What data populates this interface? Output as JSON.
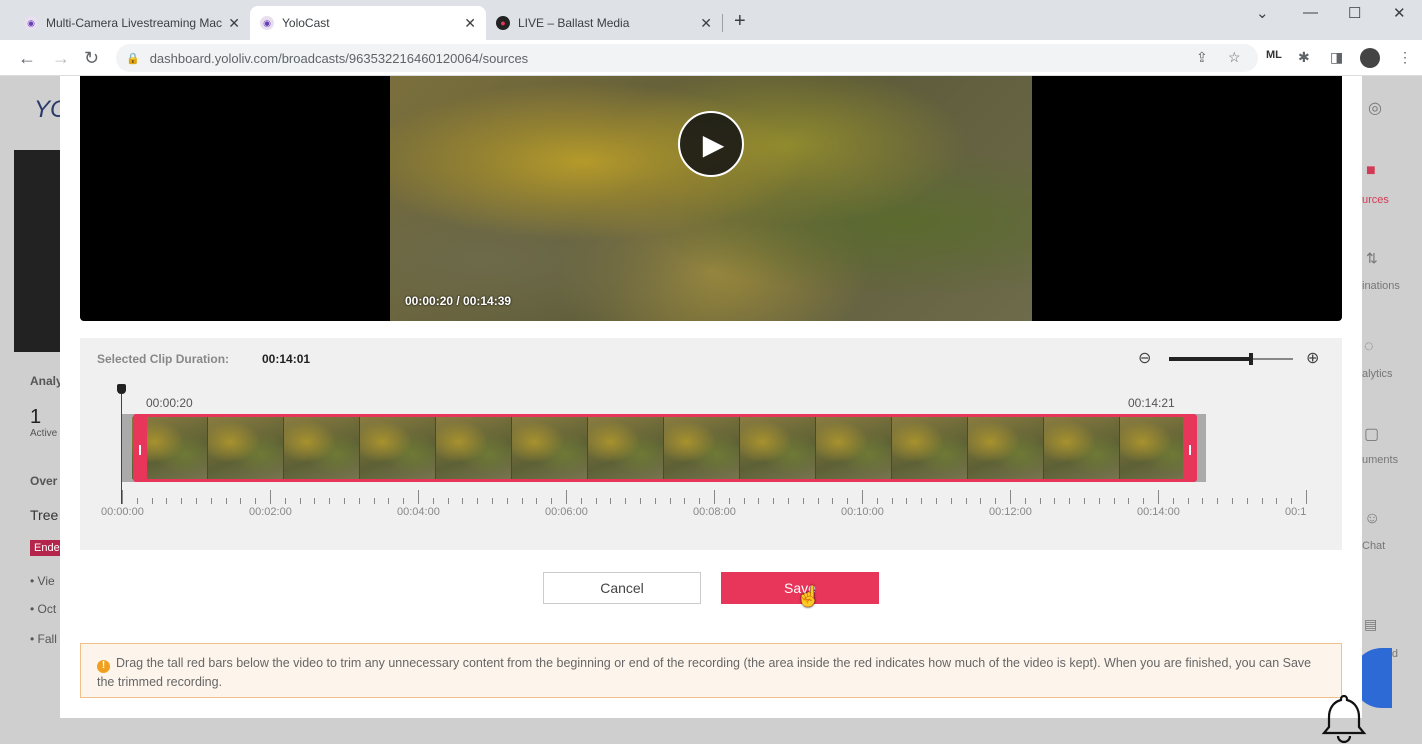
{
  "browser": {
    "tabs": [
      {
        "title": "Multi-Camera Livestreaming Mac",
        "active": false
      },
      {
        "title": "YoloCast",
        "active": true
      },
      {
        "title": "LIVE – Ballast Media",
        "active": false
      }
    ],
    "url": "dashboard.yololiv.com/broadcasts/963532216460120064/sources",
    "ext_ml": "ML"
  },
  "background": {
    "logo": "YC",
    "analytics_label": "Analy",
    "count": "1",
    "count_label": "Active",
    "overview_label": "Over",
    "title_fragment": "Tree",
    "status_badge": "Ende",
    "bullets": [
      "• Vie",
      "• Oct",
      "• Fall"
    ],
    "side_nav": [
      "urces",
      "inations",
      "alytics",
      "uments",
      "Chat",
      "oard"
    ]
  },
  "player": {
    "time_readout": "00:00:20 / 00:14:39",
    "progress": 0.0228
  },
  "trim": {
    "duration_label": "Selected Clip Duration:",
    "duration_value": "00:14:01",
    "clip_start": "00:00:20",
    "clip_end": "00:14:21",
    "zoom_level": 0.66,
    "tick_labels": [
      "00:00:00",
      "00:02:00",
      "00:04:00",
      "00:06:00",
      "00:08:00",
      "00:10:00",
      "00:12:00",
      "00:14:00",
      "00:1"
    ]
  },
  "actions": {
    "cancel_label": "Cancel",
    "save_label": "Save"
  },
  "notice": {
    "text": "Drag the tall red bars below the video to trim any unnecessary content from the beginning or end of the recording (the area inside the red indicates how much of the video is kept). When you are finished, you can Save the trimmed recording."
  },
  "colors": {
    "accent": "#e8355a",
    "notice_bg": "#fdf5ec",
    "notice_border": "#f0c08a"
  }
}
